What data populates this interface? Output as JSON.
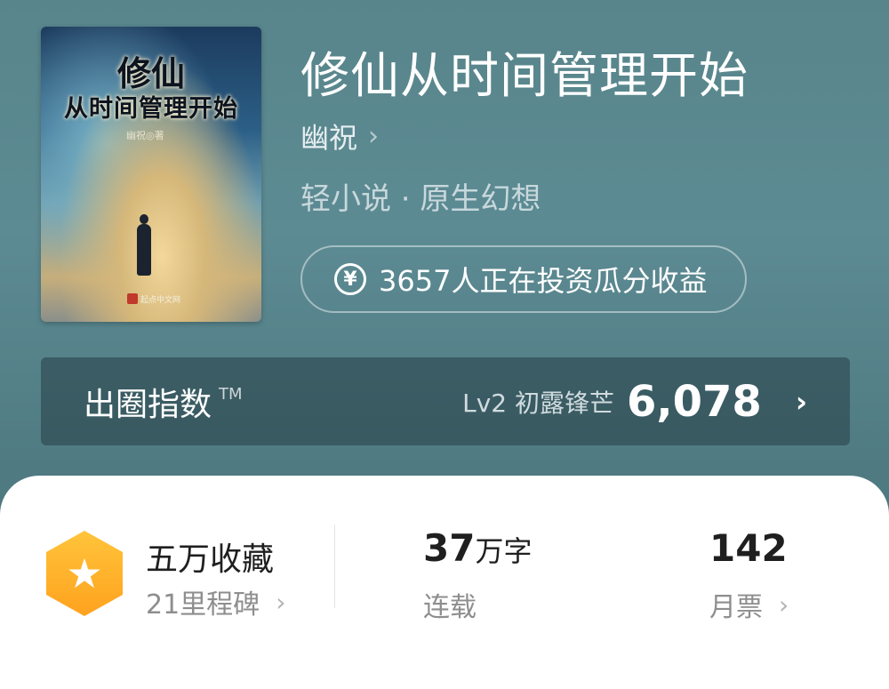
{
  "cover": {
    "title": "修仙",
    "subtitle": "从时间管理开始",
    "author_line": "幽祝◎著",
    "publisher_mark": "起点中文网"
  },
  "book": {
    "title": "修仙从时间管理开始",
    "author": "幽祝",
    "genre": "轻小说 · 原生幻想"
  },
  "invest": {
    "icon": "yen-icon",
    "icon_glyph": "¥",
    "text": "3657人正在投资瓜分收益"
  },
  "index_bar": {
    "label": "出圈指数",
    "tm": "TM",
    "level": "Lv2 初露锋芒",
    "score": "6,078",
    "chevron": "›"
  },
  "stats": {
    "collect": {
      "badge_icon": "star-icon",
      "title": "五万收藏",
      "sub": "21里程碑",
      "chevron": "›"
    },
    "words": {
      "number": "37",
      "unit": "万字",
      "sub": "连载"
    },
    "votes": {
      "number": "142",
      "sub": "月票",
      "chevron": "›"
    }
  },
  "colors": {
    "header_bg": "#5d8b93",
    "badge": "#ffb12c",
    "card_bg": "#ffffff"
  }
}
